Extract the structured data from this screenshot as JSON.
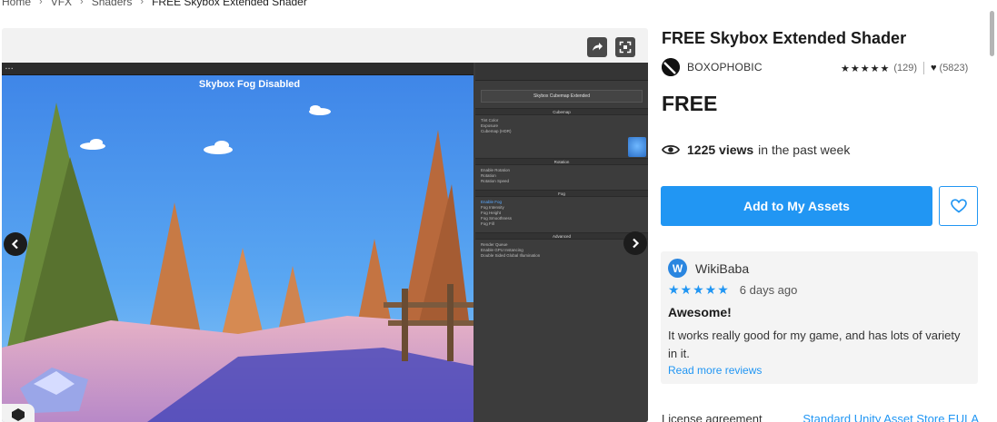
{
  "breadcrumb": {
    "items": [
      "Home",
      "VFX",
      "Shaders",
      "FREE Skybox Extended Shader"
    ]
  },
  "media": {
    "scene_caption": "Skybox Fog Disabled",
    "icons": {
      "share": "share-icon",
      "fullscreen": "fullscreen-icon",
      "prev": "chevron-left-icon",
      "next": "chevron-right-icon"
    },
    "inspector": {
      "header": "Skybox Cubemap Extended",
      "sections": [
        "Cubemap",
        "Rotation",
        "Fog",
        "Advanced"
      ],
      "cubemap_rows": [
        "Tint Color",
        "Exposure",
        "Cubemap (HDR)"
      ],
      "rotation_rows": [
        "Enable Rotation",
        "Rotation",
        "Rotation Speed"
      ],
      "fog_rows": [
        "Enable Fog",
        "Fog Intensity",
        "Fog Height",
        "Fog Smoothness",
        "Fog Fill"
      ],
      "advanced_rows": [
        "Render Queue",
        "Enable GPU Instancing",
        "Double Sided Global Illumination"
      ]
    }
  },
  "product": {
    "title": "FREE Skybox Extended Shader",
    "publisher": "BOXOPHOBIC",
    "stars": "★★★★★",
    "rating_count": "(129)",
    "favorites": "(5823)",
    "price": "FREE",
    "views_count": "1225 views",
    "views_suffix": "in the past week",
    "add_button": "Add to My Assets"
  },
  "review": {
    "avatar_letter": "W",
    "reviewer": "WikiBaba",
    "stars": "★★★★★",
    "date": "6 days ago",
    "title": "Awesome!",
    "body": "It works really good for my game, and has lots of variety in it.",
    "more_link": "Read more reviews"
  },
  "license": {
    "label": "License agreement",
    "value": "Standard Unity Asset Store EULA"
  },
  "colors": {
    "accent": "#2196f3",
    "dark": "#1a1a1a"
  }
}
